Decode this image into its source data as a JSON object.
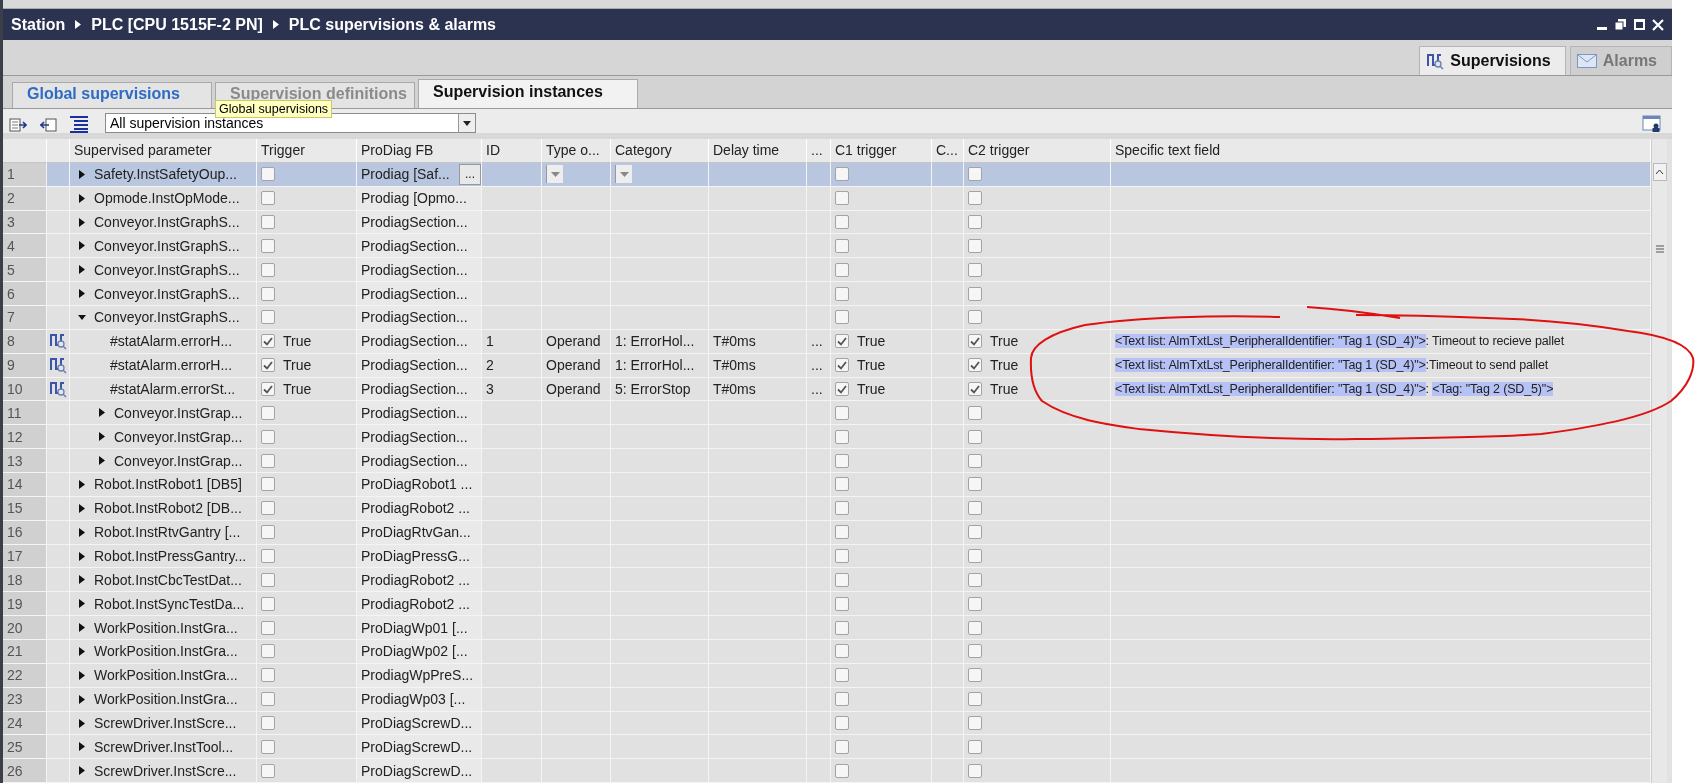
{
  "breadcrumb": [
    "Station",
    "PLC [CPU 1515F-2 PN]",
    "PLC supervisions & alarms"
  ],
  "view_tabs": [
    {
      "label": "Supervisions",
      "selected": true,
      "kind": "supervisions"
    },
    {
      "label": "Alarms",
      "selected": false,
      "kind": "alarms"
    }
  ],
  "tabs": [
    {
      "label": "Global supervisions",
      "selected": false,
      "hovered": true
    },
    {
      "label": "Supervision definitions",
      "selected": false,
      "hovered": false
    },
    {
      "label": "Supervision instances",
      "selected": true,
      "hovered": false
    }
  ],
  "tooltip": "Global supervisions",
  "filter": {
    "value": "All supervision instances"
  },
  "table": {
    "columns": [
      "Supervised parameter",
      "Trigger",
      "ProDiag FB",
      "ID",
      "Type o...",
      "Category",
      "Delay time",
      "...",
      "C1 trigger",
      "C...",
      "C2 trigger",
      "Specific text field"
    ],
    "rows": [
      {
        "n": "1",
        "param": "Safety.InstSafetyOup...",
        "kind": "group",
        "expanded": false,
        "selected": true,
        "trigger": {
          "checked": false
        },
        "fb": "Prodiag [Saf...",
        "fb_button": "...",
        "c1": {
          "checked": false
        },
        "c2": {
          "checked": false
        }
      },
      {
        "n": "2",
        "param": "Opmode.InstOpMode...",
        "kind": "group",
        "expanded": false,
        "selected": false,
        "trigger": {
          "checked": false
        },
        "fb": "Prodiag [Opmo...",
        "c1": {
          "checked": false
        },
        "c2": {
          "checked": false
        }
      },
      {
        "n": "3",
        "param": "Conveyor.InstGraphS...",
        "kind": "group",
        "expanded": false,
        "selected": false,
        "trigger": {
          "checked": false
        },
        "fb": "ProdiagSection...",
        "c1": {
          "checked": false
        },
        "c2": {
          "checked": false
        }
      },
      {
        "n": "4",
        "param": "Conveyor.InstGraphS...",
        "kind": "group",
        "expanded": false,
        "selected": false,
        "trigger": {
          "checked": false
        },
        "fb": "ProdiagSection...",
        "c1": {
          "checked": false
        },
        "c2": {
          "checked": false
        }
      },
      {
        "n": "5",
        "param": "Conveyor.InstGraphS...",
        "kind": "group",
        "expanded": false,
        "selected": false,
        "trigger": {
          "checked": false
        },
        "fb": "ProdiagSection...",
        "c1": {
          "checked": false
        },
        "c2": {
          "checked": false
        }
      },
      {
        "n": "6",
        "param": "Conveyor.InstGraphS...",
        "kind": "group",
        "expanded": false,
        "selected": false,
        "trigger": {
          "checked": false
        },
        "fb": "ProdiagSection...",
        "c1": {
          "checked": false
        },
        "c2": {
          "checked": false
        }
      },
      {
        "n": "7",
        "param": "Conveyor.InstGraphS...",
        "kind": "group",
        "expanded": true,
        "selected": false,
        "trigger": {
          "checked": false
        },
        "fb": "ProdiagSection...",
        "c1": {
          "checked": false
        },
        "c2": {
          "checked": false
        },
        "children": [
          {
            "n": "8",
            "param": "#statAlarm.errorH...",
            "kind": "alarm",
            "selected": false,
            "trigger": {
              "checked": true,
              "text": "True"
            },
            "fb": "ProdiagSection...",
            "id": "1",
            "type": "Operand",
            "category": "1: ErrorHol...",
            "delay": "T#0ms",
            "more": "...",
            "c1": {
              "checked": true,
              "text": "True"
            },
            "c2": {
              "checked": true,
              "text": "True"
            },
            "specific_text": [
              {
                "text": "<Text list: AlmTxtLst_PeripheralIdentifier: \"Tag 1 (SD_4)\">",
                "highlighted": true
              },
              {
                "text": ": Timeout to recieve pallet",
                "highlighted": false
              }
            ]
          },
          {
            "n": "9",
            "param": "#statAlarm.errorH...",
            "kind": "alarm",
            "selected": false,
            "trigger": {
              "checked": true,
              "text": "True"
            },
            "fb": "ProdiagSection...",
            "id": "2",
            "type": "Operand",
            "category": "1: ErrorHol...",
            "delay": "T#0ms",
            "more": "...",
            "c1": {
              "checked": true,
              "text": "True"
            },
            "c2": {
              "checked": true,
              "text": "True"
            },
            "specific_text": [
              {
                "text": "<Text list: AlmTxtLst_PeripheralIdentifier: \"Tag 1 (SD_4)\">",
                "highlighted": true
              },
              {
                "text": ":Timeout to send pallet",
                "highlighted": false
              }
            ]
          },
          {
            "n": "10",
            "param": "#statAlarm.errorSt...",
            "kind": "alarm",
            "selected": false,
            "trigger": {
              "checked": true,
              "text": "True"
            },
            "fb": "ProdiagSection...",
            "id": "3",
            "type": "Operand",
            "category": "5: ErrorStop",
            "delay": "T#0ms",
            "more": "...",
            "c1": {
              "checked": true,
              "text": "True"
            },
            "c2": {
              "checked": true,
              "text": "True"
            },
            "specific_text": [
              {
                "text": "<Text list: AlmTxtLst_PeripheralIdentifier: \"Tag 1 (SD_4)\">",
                "highlighted": true
              },
              {
                "text": ": ",
                "highlighted": false
              },
              {
                "text": "<Tag: \"Tag 2 (SD_5)\">",
                "highlighted": true
              }
            ]
          },
          {
            "n": "11",
            "param": "Conveyor.InstGrap...",
            "kind": "group",
            "expanded": false,
            "selected": false,
            "trigger": {
              "checked": false
            },
            "fb": "ProdiagSection...",
            "c1": {
              "checked": false
            },
            "c2": {
              "checked": false
            }
          },
          {
            "n": "12",
            "param": "Conveyor.InstGrap...",
            "kind": "group",
            "expanded": false,
            "selected": false,
            "trigger": {
              "checked": false
            },
            "fb": "ProdiagSection...",
            "c1": {
              "checked": false
            },
            "c2": {
              "checked": false
            }
          },
          {
            "n": "13",
            "param": "Conveyor.InstGrap...",
            "kind": "group",
            "expanded": false,
            "selected": false,
            "trigger": {
              "checked": false
            },
            "fb": "ProdiagSection...",
            "c1": {
              "checked": false
            },
            "c2": {
              "checked": false
            }
          }
        ]
      },
      {
        "n": "14",
        "param": "Robot.InstRobot1 [DB5]",
        "kind": "group",
        "expanded": false,
        "selected": false,
        "trigger": {
          "checked": false
        },
        "fb": "ProDiagRobot1 ...",
        "c1": {
          "checked": false
        },
        "c2": {
          "checked": false
        }
      },
      {
        "n": "15",
        "param": "Robot.InstRobot2 [DB...",
        "kind": "group",
        "expanded": false,
        "selected": false,
        "trigger": {
          "checked": false
        },
        "fb": "ProdiagRobot2 ...",
        "c1": {
          "checked": false
        },
        "c2": {
          "checked": false
        }
      },
      {
        "n": "16",
        "param": "Robot.InstRtvGantry [...",
        "kind": "group",
        "expanded": false,
        "selected": false,
        "trigger": {
          "checked": false
        },
        "fb": "ProDiagRtvGan...",
        "c1": {
          "checked": false
        },
        "c2": {
          "checked": false
        }
      },
      {
        "n": "17",
        "param": "Robot.InstPressGantry...",
        "kind": "group",
        "expanded": false,
        "selected": false,
        "trigger": {
          "checked": false
        },
        "fb": "ProDiagPressG...",
        "c1": {
          "checked": false
        },
        "c2": {
          "checked": false
        }
      },
      {
        "n": "18",
        "param": "Robot.InstCbcTestDat...",
        "kind": "group",
        "expanded": false,
        "selected": false,
        "trigger": {
          "checked": false
        },
        "fb": "ProdiagRobot2 ...",
        "c1": {
          "checked": false
        },
        "c2": {
          "checked": false
        }
      },
      {
        "n": "19",
        "param": "Robot.InstSyncTestDa...",
        "kind": "group",
        "expanded": false,
        "selected": false,
        "trigger": {
          "checked": false
        },
        "fb": "ProdiagRobot2 ...",
        "c1": {
          "checked": false
        },
        "c2": {
          "checked": false
        }
      },
      {
        "n": "20",
        "param": "WorkPosition.InstGra...",
        "kind": "group",
        "expanded": false,
        "selected": false,
        "trigger": {
          "checked": false
        },
        "fb": "ProDiagWp01 [...",
        "c1": {
          "checked": false
        },
        "c2": {
          "checked": false
        }
      },
      {
        "n": "21",
        "param": "WorkPosition.InstGra...",
        "kind": "group",
        "expanded": false,
        "selected": false,
        "trigger": {
          "checked": false
        },
        "fb": "ProDiagWp02 [...",
        "c1": {
          "checked": false
        },
        "c2": {
          "checked": false
        }
      },
      {
        "n": "22",
        "param": "WorkPosition.InstGra...",
        "kind": "group",
        "expanded": false,
        "selected": false,
        "trigger": {
          "checked": false
        },
        "fb": "ProdiagWpPreS...",
        "c1": {
          "checked": false
        },
        "c2": {
          "checked": false
        }
      },
      {
        "n": "23",
        "param": "WorkPosition.InstGra...",
        "kind": "group",
        "expanded": false,
        "selected": false,
        "trigger": {
          "checked": false
        },
        "fb": "ProdiagWp03 [...",
        "c1": {
          "checked": false
        },
        "c2": {
          "checked": false
        }
      },
      {
        "n": "24",
        "param": "ScrewDriver.InstScre...",
        "kind": "group",
        "expanded": false,
        "selected": false,
        "trigger": {
          "checked": false
        },
        "fb": "ProDiagScrewD...",
        "c1": {
          "checked": false
        },
        "c2": {
          "checked": false
        }
      },
      {
        "n": "25",
        "param": "ScrewDriver.InstTool...",
        "kind": "group",
        "expanded": false,
        "selected": false,
        "trigger": {
          "checked": false
        },
        "fb": "ProDiagScrewD...",
        "c1": {
          "checked": false
        },
        "c2": {
          "checked": false
        }
      },
      {
        "n": "26",
        "param": "ScrewDriver.InstScre...",
        "kind": "group",
        "expanded": false,
        "selected": false,
        "trigger": {
          "checked": false
        },
        "fb": "ProDiagScrewD...",
        "c1": {
          "checked": false
        },
        "c2": {
          "checked": false
        }
      }
    ]
  }
}
